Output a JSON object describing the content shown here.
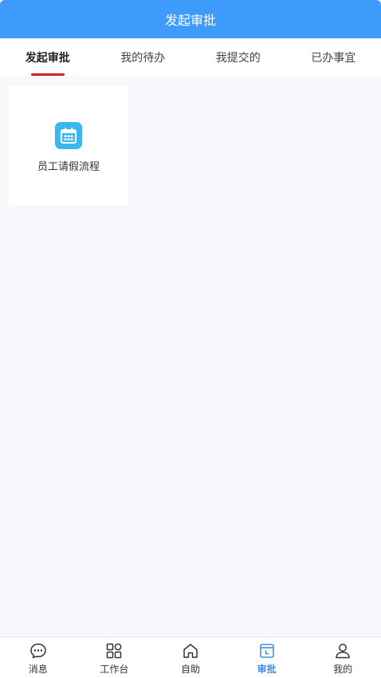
{
  "header": {
    "title": "发起审批"
  },
  "tabs": [
    {
      "label": "发起审批",
      "active": true
    },
    {
      "label": "我的待办",
      "active": false
    },
    {
      "label": "我提交的",
      "active": false
    },
    {
      "label": "已办事宜",
      "active": false
    }
  ],
  "cards": [
    {
      "label": "员工请假流程",
      "icon": "calendar-icon",
      "icon_color": "#3ab8ee"
    }
  ],
  "bottom_nav": [
    {
      "label": "消息",
      "icon": "chat-bubble-icon",
      "active": false
    },
    {
      "label": "工作台",
      "icon": "grid-icon",
      "active": false
    },
    {
      "label": "自助",
      "icon": "home-icon",
      "active": false
    },
    {
      "label": "审批",
      "icon": "approval-icon",
      "active": true
    },
    {
      "label": "我的",
      "icon": "user-icon",
      "active": false
    }
  ],
  "colors": {
    "header_bg": "#3d9bfb",
    "tab_indicator": "#d9192d",
    "nav_active": "#3d8fe6",
    "page_bg": "#f8f7fc"
  }
}
